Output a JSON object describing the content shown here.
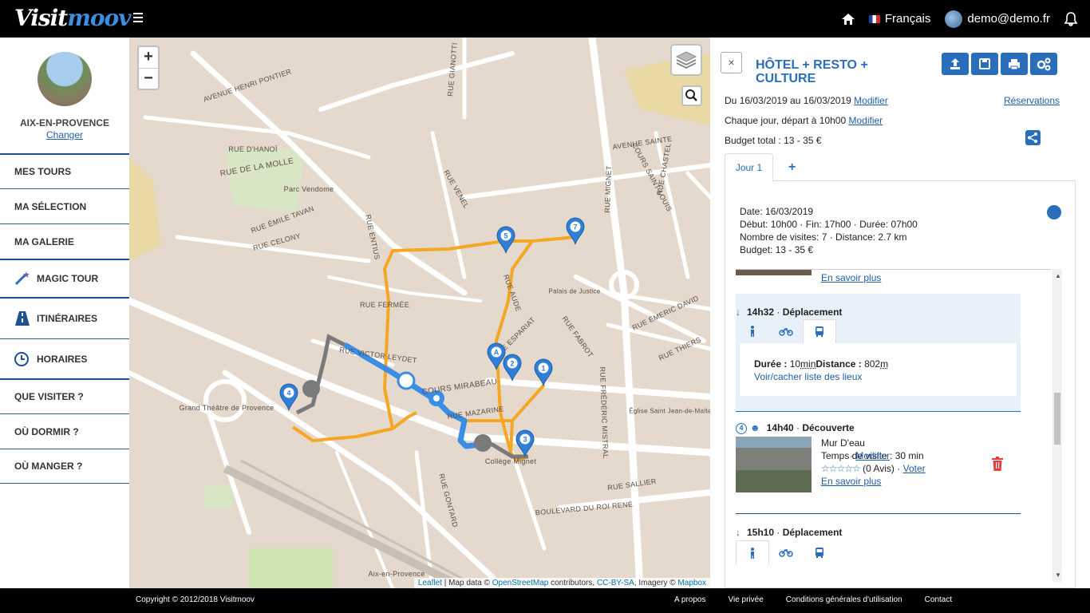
{
  "app": {
    "logo_part1": "Visit",
    "logo_part2": "moov"
  },
  "topbar": {
    "language": "Français",
    "user": "demo@demo.fr"
  },
  "sidebar": {
    "city": "AIX-EN-PROVENCE",
    "change": "Changer",
    "items": [
      {
        "label": "MES TOURS"
      },
      {
        "label": "MA SÉLECTION"
      },
      {
        "label": "MA GALERIE"
      },
      {
        "label": "MAGIC TOUR"
      },
      {
        "label": "ITINÉRAIRES"
      },
      {
        "label": "HORAIRES"
      },
      {
        "label": "QUE VISITER ?"
      },
      {
        "label": "OÙ DORMIR ?"
      },
      {
        "label": "OÙ MANGER ?"
      }
    ]
  },
  "map": {
    "zoom_in": "+",
    "zoom_out": "−",
    "attribution_leaflet": "Leaflet",
    "attribution_text": " | Map data © ",
    "attribution_osm": "OpenStreetMap",
    "attribution_contrib": " contributors, ",
    "attribution_cc": "CC-BY-SA",
    "attribution_imagery": ", Imagery © ",
    "attribution_mapbox": "Mapbox",
    "labels": [
      {
        "text": "AVENUE HENRI PONTIER"
      },
      {
        "text": "RUE D'HANOÏ"
      },
      {
        "text": "RUE DE LA MOLLE"
      },
      {
        "text": "Parc Vendome"
      },
      {
        "text": "RUE ÉMILE TAVAN"
      },
      {
        "text": "RUE CELONY"
      },
      {
        "text": "RUE FERMÉE"
      },
      {
        "text": "RUE VICTOR LEYDET"
      },
      {
        "text": "COURS MIRABEAU"
      },
      {
        "text": "RUE MAZARINE"
      },
      {
        "text": "Grand Théâtre de Provence"
      },
      {
        "text": "Collège Mignet"
      },
      {
        "text": "Palais de Justice"
      },
      {
        "text": "AVENUE SAINTE"
      },
      {
        "text": "COURS SAINT-LOUIS"
      },
      {
        "text": "RUE MIGNET"
      },
      {
        "text": "RUE ESPARIAT"
      },
      {
        "text": "RUE FABROT"
      },
      {
        "text": "RUE FRÉDÉRIC MISTRAL"
      },
      {
        "text": "RUE SALLIER"
      },
      {
        "text": "BOULEVARD DU ROI RENÉ"
      },
      {
        "text": "RUE GONTARD"
      },
      {
        "text": "RUE ENTIUS"
      },
      {
        "text": "RUE VENEL"
      },
      {
        "text": "RUE AUDE"
      },
      {
        "text": "RUE GIANOTTI"
      },
      {
        "text": "Aix-en-Provence"
      },
      {
        "text": "Église Saint Jean-de-Malte"
      },
      {
        "text": "RUE ÉMERIC DAVID"
      },
      {
        "text": "RUE THIERS"
      },
      {
        "text": "RUE CHASTEL"
      }
    ],
    "markers": [
      "5",
      "7",
      "A",
      "2",
      "1",
      "4",
      "3"
    ]
  },
  "panel": {
    "close": "×",
    "title": "HÔTEL + RESTO + CULTURE",
    "dates_prefix": "Du ",
    "date_from": "16/03/2019",
    "dates_mid": " au ",
    "date_to": "16/03/2019",
    "modify": "Modifier",
    "reservations": "Réservations",
    "schedule_prefix": "Chaque jour, départ à ",
    "schedule_time": "10h00",
    "budget_prefix": "Budget total : ",
    "budget": "13 - 35 €",
    "tab_day": "Jour 1",
    "tab_add": "+",
    "day": {
      "date_label": "Date: ",
      "date": "16/03/2019",
      "start_label": "Début: ",
      "start": "10h00",
      "end_label": " · Fin: ",
      "end": "17h00",
      "duration_label": " · Durée: ",
      "duration": "07h00",
      "visits_label": "Nombre de visites: ",
      "visits": "7",
      "distance_label": " · Distance: ",
      "distance": "2.7 km",
      "budget_label": "Budget: ",
      "budget": "13 - 35 €"
    },
    "prev_link": "En savoir plus",
    "move1": {
      "time": "14h32",
      "type": "Déplacement",
      "duration_label": "Durée : ",
      "duration_value": "10",
      "duration_unit": "min",
      "distance_label": "Distance : ",
      "distance_value": "802",
      "distance_unit": "m",
      "toggle": "Voir/cacher liste des lieux"
    },
    "visit4": {
      "number": "4",
      "time": "14h40",
      "type": "Découverte",
      "name": "Mur D'eau",
      "visit_time": "Temps de visite : 30 min",
      "modify": "Modifier",
      "stars": "☆☆☆☆☆",
      "reviews": "(0 Avis)",
      "vote": "Voter",
      "more": "En savoir plus"
    },
    "move2": {
      "time": "15h10",
      "type": "Déplacement"
    }
  },
  "footer": {
    "copyright": "Copyright © 2012/2018 Visitmoov",
    "links": [
      "A propos",
      "Vie privée",
      "Conditions générales d'utilisation",
      "Contact"
    ]
  },
  "colors": {
    "accent": "#2a6ebb",
    "route_walk": "#f5a623",
    "route_bus": "#3b8ee8",
    "route_gray": "#7a7a7a"
  }
}
